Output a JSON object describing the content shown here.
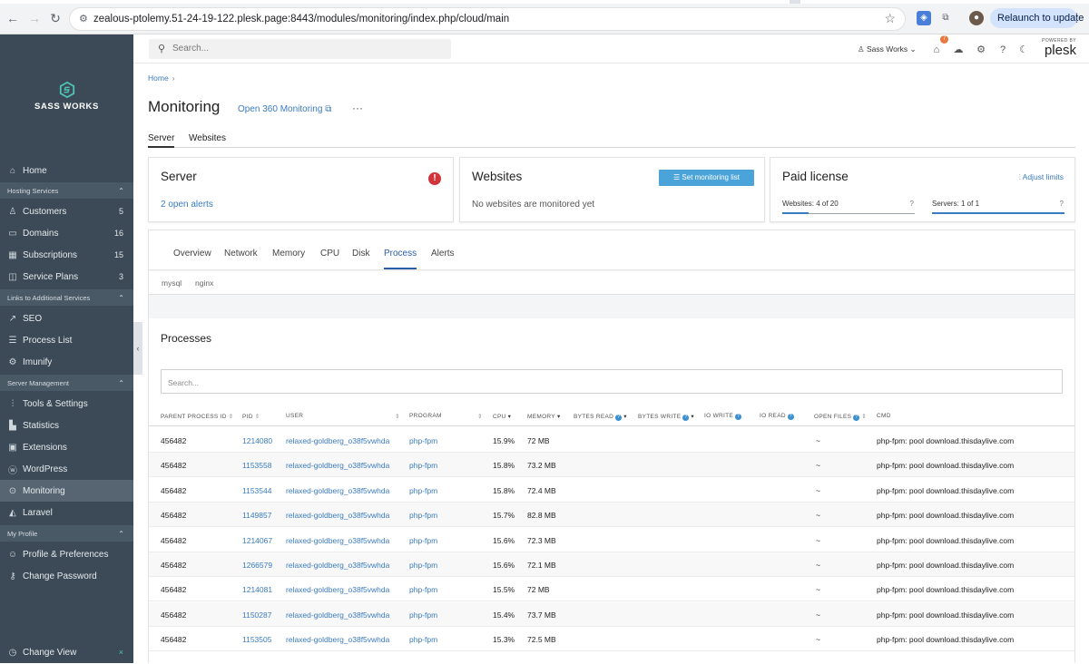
{
  "browser": {
    "url": "zealous-ptolemy.51-24-19-122.plesk.page:8443/modules/monitoring/index.php/cloud/main",
    "relaunch_label": "Relaunch to update"
  },
  "sidebar": {
    "brand": "SASS WORKS",
    "items": [
      {
        "label": "Home",
        "icon": "home-icon"
      },
      {
        "section": "Hosting Services"
      },
      {
        "label": "Customers",
        "count": "5",
        "icon": "person-icon"
      },
      {
        "label": "Domains",
        "count": "16",
        "icon": "monitor-icon"
      },
      {
        "label": "Subscriptions",
        "count": "15",
        "icon": "grid-icon"
      },
      {
        "label": "Service Plans",
        "count": "3",
        "icon": "plan-icon"
      },
      {
        "section": "Links to Additional Services"
      },
      {
        "label": "SEO",
        "icon": "chart-icon"
      },
      {
        "label": "Process List",
        "icon": "list-icon"
      },
      {
        "label": "Imunify",
        "icon": "gear-icon"
      },
      {
        "section": "Server Management"
      },
      {
        "label": "Tools & Settings",
        "icon": "sliders-icon"
      },
      {
        "label": "Statistics",
        "icon": "bar-chart-icon"
      },
      {
        "label": "Extensions",
        "icon": "extensions-icon"
      },
      {
        "label": "WordPress",
        "icon": "wordpress-icon"
      },
      {
        "label": "Monitoring",
        "icon": "monitoring-icon",
        "active": true
      },
      {
        "label": "Laravel",
        "icon": "laravel-icon"
      },
      {
        "section": "My Profile"
      },
      {
        "label": "Profile & Preferences",
        "icon": "profile-icon"
      },
      {
        "label": "Change Password",
        "icon": "key-icon"
      }
    ],
    "change_view": "Change View"
  },
  "header": {
    "search_placeholder": "Search...",
    "user": "Sass Works",
    "notif_count": "7",
    "powered_by": "POWERED BY",
    "plesk": "plesk"
  },
  "page": {
    "breadcrumb": "Home",
    "title": "Monitoring",
    "open360": "Open 360 Monitoring",
    "tabs": [
      "Server",
      "Websites"
    ]
  },
  "cards": {
    "server": {
      "title": "Server",
      "link": "2 open alerts"
    },
    "websites": {
      "title": "Websites",
      "button": "Set monitoring list",
      "text": "No websites are monitored yet"
    },
    "license": {
      "title": "Paid license",
      "adjust": "Adjust limits",
      "websites": "Websites: 4 of 20",
      "servers": "Servers: 1 of 1",
      "websites_fill": 0.2,
      "servers_fill": 1.0
    }
  },
  "monitor_tabs": [
    "Overview",
    "Network",
    "Memory",
    "CPU",
    "Disk",
    "Process",
    "Alerts"
  ],
  "process_tabs": [
    "mysql",
    "nginx"
  ],
  "processes": {
    "title": "Processes",
    "search_placeholder": "Search...",
    "columns": [
      "PARENT PROCESS ID",
      "PID",
      "USER",
      "PROGRAM",
      "CPU",
      "MEMORY",
      "BYTES READ",
      "BYTES WRITE",
      "IO WRITE",
      "IO READ",
      "OPEN FILES",
      "CMD"
    ],
    "rows": [
      {
        "ppid": "456482",
        "pid": "1214080",
        "user": "relaxed-goldberg_o38f5vwhda",
        "program": "php-fpm",
        "cpu": "15.9%",
        "memory": "72 MB",
        "open_files": "~",
        "cmd": "php-fpm: pool download.thisdaylive.com"
      },
      {
        "ppid": "456482",
        "pid": "1153558",
        "user": "relaxed-goldberg_o38f5vwhda",
        "program": "php-fpm",
        "cpu": "15.8%",
        "memory": "73.2 MB",
        "open_files": "~",
        "cmd": "php-fpm: pool download.thisdaylive.com"
      },
      {
        "ppid": "456482",
        "pid": "1153544",
        "user": "relaxed-goldberg_o38f5vwhda",
        "program": "php-fpm",
        "cpu": "15.8%",
        "memory": "72.4 MB",
        "open_files": "~",
        "cmd": "php-fpm: pool download.thisdaylive.com"
      },
      {
        "ppid": "456482",
        "pid": "1149857",
        "user": "relaxed-goldberg_o38f5vwhda",
        "program": "php-fpm",
        "cpu": "15.7%",
        "memory": "82.8 MB",
        "open_files": "~",
        "cmd": "php-fpm: pool download.thisdaylive.com"
      },
      {
        "ppid": "456482",
        "pid": "1214067",
        "user": "relaxed-goldberg_o38f5vwhda",
        "program": "php-fpm",
        "cpu": "15.6%",
        "memory": "72.3 MB",
        "open_files": "~",
        "cmd": "php-fpm: pool download.thisdaylive.com"
      },
      {
        "ppid": "456482",
        "pid": "1266579",
        "user": "relaxed-goldberg_o38f5vwhda",
        "program": "php-fpm",
        "cpu": "15.6%",
        "memory": "72.1 MB",
        "open_files": "~",
        "cmd": "php-fpm: pool download.thisdaylive.com"
      },
      {
        "ppid": "456482",
        "pid": "1214081",
        "user": "relaxed-goldberg_o38f5vwhda",
        "program": "php-fpm",
        "cpu": "15.5%",
        "memory": "72 MB",
        "open_files": "~",
        "cmd": "php-fpm: pool download.thisdaylive.com"
      },
      {
        "ppid": "456482",
        "pid": "1150287",
        "user": "relaxed-goldberg_o38f5vwhda",
        "program": "php-fpm",
        "cpu": "15.4%",
        "memory": "73.7 MB",
        "open_files": "~",
        "cmd": "php-fpm: pool download.thisdaylive.com"
      },
      {
        "ppid": "456482",
        "pid": "1153505",
        "user": "relaxed-goldberg_o38f5vwhda",
        "program": "php-fpm",
        "cpu": "15.3%",
        "memory": "72.5 MB",
        "open_files": "~",
        "cmd": "php-fpm: pool download.thisdaylive.com"
      }
    ]
  }
}
